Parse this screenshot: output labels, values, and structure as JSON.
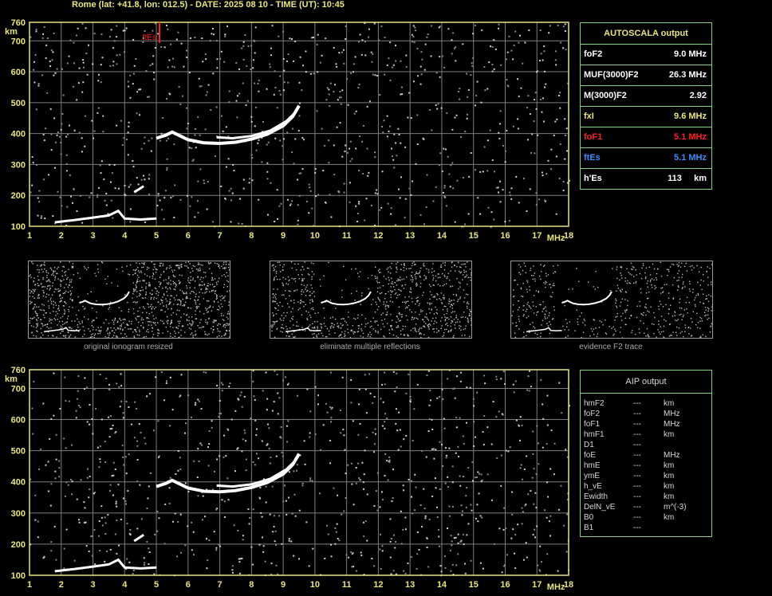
{
  "header": "Rome (lat: +41.8, lon: 012.5) - DATE: 2025 08 10 - TIME (UT): 10:45",
  "axes": {
    "y_ticks": [
      "760",
      "700",
      "600",
      "500",
      "400",
      "300",
      "200",
      "100"
    ],
    "y_values": [
      760,
      700,
      600,
      500,
      400,
      300,
      200,
      100
    ],
    "y_unit": "km",
    "x_ticks": [
      "1",
      "2",
      "3",
      "4",
      "5",
      "6",
      "7",
      "8",
      "9",
      "10",
      "11",
      "12",
      "13",
      "14",
      "15",
      "16",
      "17",
      "18"
    ],
    "x_unit": "MHz",
    "x_range": [
      1,
      18
    ],
    "y_range": [
      100,
      760
    ]
  },
  "ftes_marker": {
    "label": "ftEs",
    "freq": 5.1,
    "color": "#ff2020"
  },
  "autoscala": {
    "title": "AUTOSCALA output",
    "rows": [
      {
        "key": "foF2",
        "value": "9.0 MHz",
        "color": "#ffffff"
      },
      {
        "key": "MUF(3000)F2",
        "value": "26.3 MHz",
        "color": "#ffffff"
      },
      {
        "key": "M(3000)F2",
        "value": "2.92",
        "color": "#ffffff"
      },
      {
        "key": "fxI",
        "value": "9.6 MHz",
        "color": "#e8e67a"
      },
      {
        "key": "foF1",
        "value": "5.1 MHz",
        "color": "#ff2020"
      },
      {
        "key": "ftEs",
        "value": "5.1 MHz",
        "color": "#3a8cff"
      },
      {
        "key": "h'Es",
        "value": "113     km",
        "color": "#ffffff"
      }
    ]
  },
  "thumbnails": [
    {
      "caption": "original ionogram resized"
    },
    {
      "caption": "eliminate multiple reflections"
    },
    {
      "caption": "evidence F2 trace"
    }
  ],
  "aip": {
    "title": "AIP output",
    "rows": [
      {
        "name": "hmF2",
        "value": "---",
        "unit": "km"
      },
      {
        "name": "foF2",
        "value": "---",
        "unit": "MHz"
      },
      {
        "name": "foF1",
        "value": "---",
        "unit": "MHz"
      },
      {
        "name": "hmF1",
        "value": "---",
        "unit": "km"
      },
      {
        "name": "D1",
        "value": "---",
        "unit": ""
      },
      {
        "name": "foE",
        "value": "---",
        "unit": "MHz"
      },
      {
        "name": "hmE",
        "value": "---",
        "unit": "km"
      },
      {
        "name": "ymE",
        "value": "---",
        "unit": "km"
      },
      {
        "name": "h_vE",
        "value": "---",
        "unit": "km"
      },
      {
        "name": "Ewidth",
        "value": "---",
        "unit": "km"
      },
      {
        "name": "DelN_vE",
        "value": "---",
        "unit": "m^(-3)"
      },
      {
        "name": "B0",
        "value": "---",
        "unit": "km"
      },
      {
        "name": "B1",
        "value": "---",
        "unit": ""
      }
    ]
  },
  "colors": {
    "grid": "#7d7d7d",
    "frame": "#e8e67a",
    "trace": "#ffffff",
    "panel_border": "#7fd07f",
    "tick_text": "#e8e67a"
  }
}
